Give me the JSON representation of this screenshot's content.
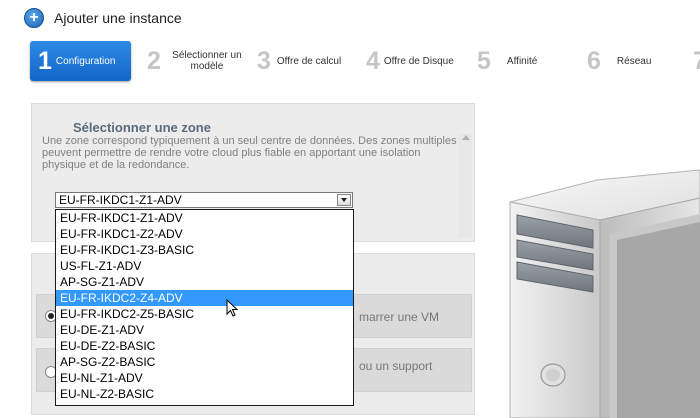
{
  "page": {
    "title": "Ajouter une instance"
  },
  "steps": [
    {
      "num": "1",
      "label": "Configuration"
    },
    {
      "num": "2",
      "label": "Sélectionner un modèle"
    },
    {
      "num": "3",
      "label": "Offre de calcul"
    },
    {
      "num": "4",
      "label": "Offre de Disque"
    },
    {
      "num": "5",
      "label": "Affinité"
    },
    {
      "num": "6",
      "label": "Réseau"
    },
    {
      "num": "7",
      "label": ""
    }
  ],
  "zone": {
    "heading": "Sélectionner une zone",
    "description": "Une zone correspond typiquement à un seul centre de données. Des zones multiples peuvent permettre de rendre votre cloud plus fiable en apportant une isolation physique et de la redondance.",
    "selected": "EU-FR-IKDC1-Z1-ADV"
  },
  "dropdown_options": [
    "EU-FR-IKDC1-Z1-ADV",
    "EU-FR-IKDC1-Z2-ADV",
    "EU-FR-IKDC1-Z3-BASIC",
    "US-FL-Z1-ADV",
    "AP-SG-Z1-ADV",
    "EU-FR-IKDC2-Z4-ADV",
    "EU-FR-IKDC2-Z5-BASIC",
    "EU-DE-Z1-ADV",
    "EU-DE-Z2-BASIC",
    "AP-SG-Z2-BASIC",
    "EU-NL-Z1-ADV",
    "EU-NL-Z2-BASIC"
  ],
  "highlighted_option": "EU-FR-IKDC2-Z4-ADV",
  "radios": [
    {
      "text_fragment": "marrer une VM",
      "checked": true
    },
    {
      "text_fragment": "ou un support",
      "checked": false
    }
  ],
  "colors": {
    "accent": "#1a75d6",
    "highlight": "#3399ff"
  }
}
